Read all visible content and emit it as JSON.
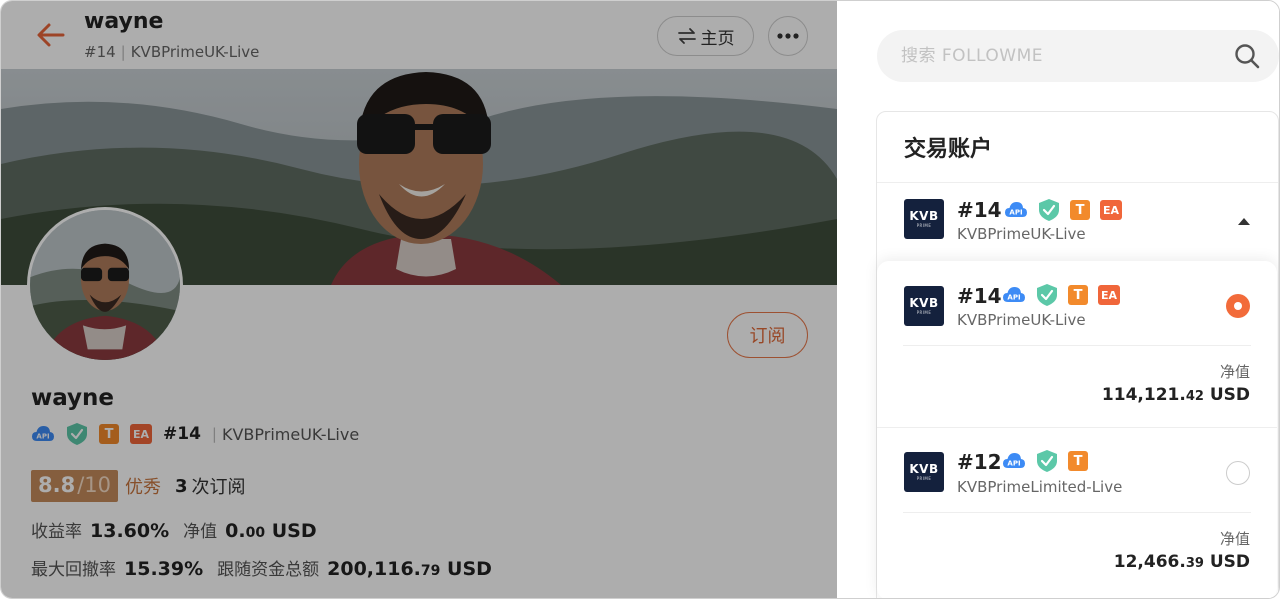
{
  "header": {
    "name": "wayne",
    "rank": "#14",
    "account": "KVBPrimeUK-Live",
    "home_label": "主页",
    "home_icon": "swap-icon",
    "more_icon": "more-dots-icon",
    "back_icon": "arrow-left-icon"
  },
  "profile": {
    "name": "wayne",
    "subscribe_label": "订阅",
    "badges": {
      "api": "API",
      "t": "T",
      "ea": "EA"
    },
    "rank": "#14",
    "account": "KVBPrimeUK-Live",
    "score": "8.8",
    "score_max": "/10",
    "score_word": "优秀",
    "subscriptions_count": "3",
    "subscriptions_label": "次订阅",
    "stats": {
      "return_label": "收益率",
      "return_value": "13.60%",
      "equity_label": "净值",
      "equity_main": "0.",
      "equity_dec": "00",
      "equity_unit": "USD",
      "drawdown_label": "最大回撤率",
      "drawdown_value": "15.39%",
      "follow_label": "跟随资金总额",
      "follow_main": "200,116.",
      "follow_dec": "79",
      "follow_unit": "USD"
    }
  },
  "search": {
    "placeholder": "搜索 FOLLOWME",
    "value": ""
  },
  "accounts_panel": {
    "title": "交易账户",
    "selected": {
      "logo_line1": "KVB",
      "logo_line2": "PRIME",
      "rank": "#14",
      "account": "KVBPrimeUK-Live",
      "badges": {
        "api": "API",
        "t": "T",
        "ea": "EA"
      }
    },
    "options": [
      {
        "logo_line1": "KVB",
        "logo_line2": "PRIME",
        "rank": "#14",
        "account": "KVBPrimeUK-Live",
        "badges": {
          "api": "API",
          "t": "T",
          "ea": "EA"
        },
        "selected": true,
        "equity_label": "净值",
        "equity_main": "114,121.",
        "equity_dec": "42",
        "equity_unit": "USD"
      },
      {
        "logo_line1": "KVB",
        "logo_line2": "PRIME",
        "rank": "#12",
        "account": "KVBPrimeLimited-Live",
        "badges": {
          "api": "API",
          "t": "T"
        },
        "selected": false,
        "equity_label": "净值",
        "equity_main": "12,466.",
        "equity_dec": "39",
        "equity_unit": "USD"
      }
    ]
  },
  "colors": {
    "accent": "#f26b3a",
    "score_bg": "#c58b5c",
    "badge_t": "#f28a2c",
    "badge_ea": "#f0663a",
    "badge_api": "#3d8bf5",
    "badge_shield": "#5cc8a8",
    "logo_bg": "#14213d"
  }
}
